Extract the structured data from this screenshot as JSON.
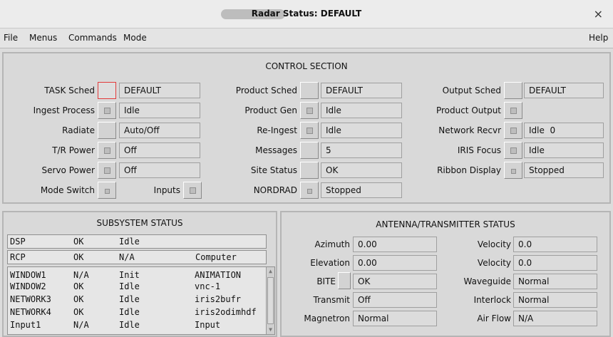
{
  "window": {
    "title": "Radar Status: DEFAULT",
    "close_glyph": "×"
  },
  "menu": {
    "file": "File",
    "menus": "Menus",
    "commands": "Commands",
    "mode": "Mode",
    "help": "Help"
  },
  "control": {
    "title": "CONTROL SECTION",
    "col1": [
      {
        "label": "TASK Sched",
        "value": "DEFAULT"
      },
      {
        "label": "Ingest Process",
        "value": "Idle"
      },
      {
        "label": "Radiate",
        "value": "Auto/Off"
      },
      {
        "label": "T/R Power",
        "value": "Off"
      },
      {
        "label": "Servo Power",
        "value": "Off"
      },
      {
        "label": "Mode Switch"
      }
    ],
    "inputs_label": "Inputs",
    "col2": [
      {
        "label": "Product Sched",
        "value": "DEFAULT"
      },
      {
        "label": "Product Gen",
        "value": "Idle"
      },
      {
        "label": "Re-Ingest",
        "value": "Idle"
      },
      {
        "label": "Messages",
        "value": "5"
      },
      {
        "label": "Site Status",
        "value": "OK"
      },
      {
        "label": "NORDRAD",
        "value": "Stopped"
      }
    ],
    "col3": [
      {
        "label": "Output Sched",
        "value": "DEFAULT"
      },
      {
        "label": "Product Output"
      },
      {
        "label": "Network Recvr",
        "value": "Idle  0"
      },
      {
        "label": "IRIS Focus",
        "value": "Idle"
      },
      {
        "label": "Ribbon Display",
        "value": "Stopped"
      }
    ]
  },
  "subsystem": {
    "title": "SUBSYSTEM STATUS",
    "rows": [
      [
        "DSP",
        "OK",
        "Idle",
        ""
      ],
      [
        "RCP",
        "OK",
        "N/A",
        "Computer"
      ]
    ],
    "list": [
      [
        "WINDOW1",
        "N/A",
        "Init",
        "ANIMATION"
      ],
      [
        "WINDOW2",
        "OK",
        "Idle",
        "vnc-1"
      ],
      [
        "NETWORK3",
        "OK",
        "Idle",
        "iris2bufr"
      ],
      [
        "NETWORK4",
        "OK",
        "Idle",
        "iris2odimhdf"
      ],
      [
        "Input1",
        "N/A",
        "Idle",
        "Input"
      ]
    ]
  },
  "antenna": {
    "title": "ANTENNA/TRANSMITTER STATUS",
    "left": [
      {
        "label": "Azimuth",
        "value": "0.00"
      },
      {
        "label": "Elevation",
        "value": "0.00"
      },
      {
        "label": "BITE",
        "value": "OK"
      },
      {
        "label": "Transmit",
        "value": "Off"
      },
      {
        "label": "Magnetron",
        "value": "Normal"
      }
    ],
    "right": [
      {
        "label": "Velocity",
        "value": "0.0"
      },
      {
        "label": "Velocity",
        "value": "0.0"
      },
      {
        "label": "Waveguide",
        "value": "Normal"
      },
      {
        "label": "Interlock",
        "value": "Normal"
      },
      {
        "label": "Air Flow",
        "value": "N/A"
      }
    ]
  }
}
